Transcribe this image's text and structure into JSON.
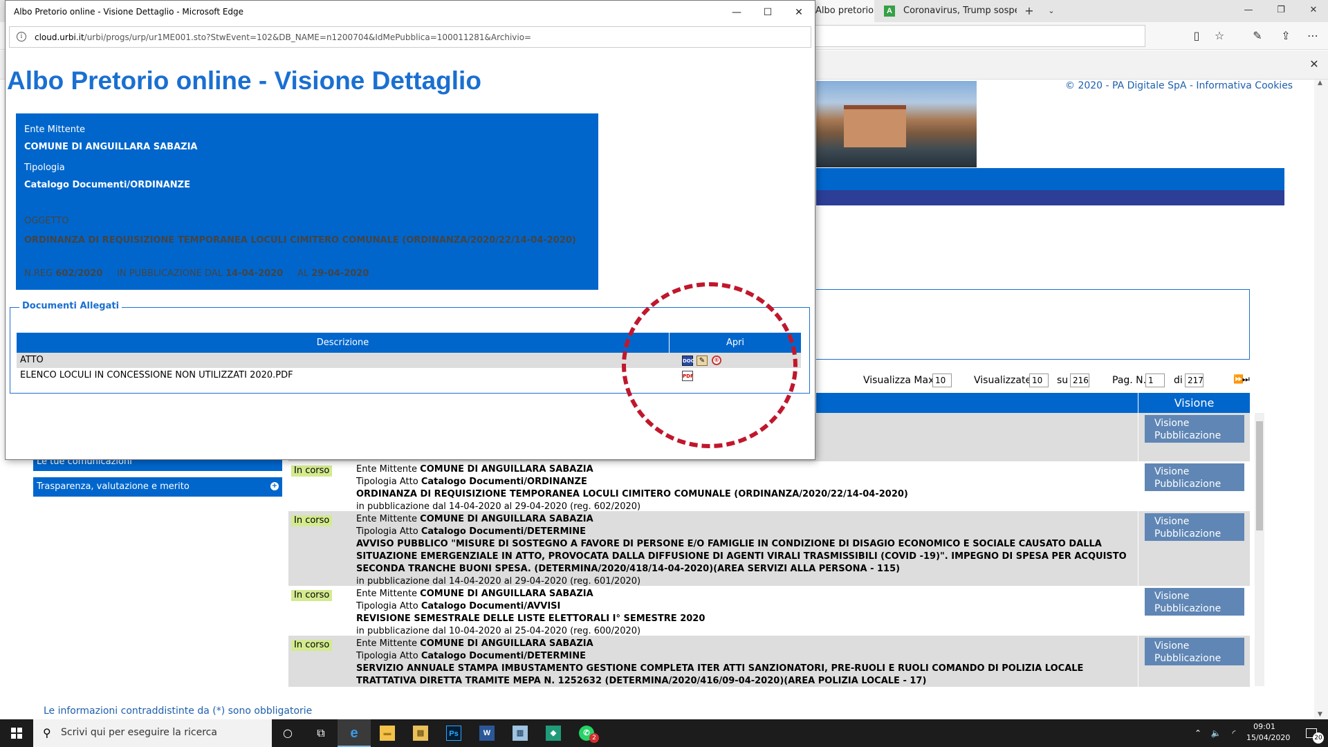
{
  "bg_browser": {
    "tabs": [
      {
        "label": "Albo pretorio o"
      },
      {
        "label": "Coronavirus, Trump sospende",
        "favicon": "A"
      }
    ],
    "window_controls": {
      "minimize": "—",
      "maximize": "❐",
      "close": "✕"
    },
    "notify_close": "✕"
  },
  "bg_page": {
    "copyright": "© 2020 - PA Digitale SpA - Informativa Cookies",
    "pager": {
      "visualizza_max_label": "Visualizza Max.",
      "visualizza_max_value": "10",
      "visualizzate_label": "Visualizzate",
      "visualizzate_value": "10",
      "su_label": "su",
      "su_value": "216",
      "pag_label": "Pag. N.",
      "pag_value": "1",
      "di_label": "di",
      "di_value": "217",
      "nav": "⏩⏭"
    },
    "list_header_visione": "Visione",
    "sidebar": [
      {
        "label": "Le tue comunicazioni"
      },
      {
        "label": "Trasparenza, valutazione e merito"
      }
    ],
    "rows": [
      {
        "status": "",
        "text": [],
        "button": "Visione Pubblicazione"
      },
      {
        "status": "In corso",
        "ente_label": "Ente Mittente ",
        "ente": "COMUNE DI ANGUILLARA SABAZIA",
        "tipologia_label": "Tipologia Atto ",
        "tipologia": "Catalogo Documenti/ORDINANZE",
        "oggetto": "ORDINANZA DI REQUISIZIONE TEMPORANEA LOCULI CIMITERO COMUNALE (ORDINANZA/2020/22/14-04-2020)",
        "pubblicazione": "in pubblicazione dal 14-04-2020 al 29-04-2020 (reg. 602/2020)",
        "button": "Visione Pubblicazione"
      },
      {
        "status": "In corso",
        "ente_label": "Ente Mittente ",
        "ente": "COMUNE DI ANGUILLARA SABAZIA",
        "tipologia_label": "Tipologia Atto ",
        "tipologia": "Catalogo Documenti/DETERMINE",
        "oggetto": "AVVISO PUBBLICO \"MISURE DI SOSTEGNO A FAVORE DI PERSONE E/O FAMIGLIE IN CONDIZIONE DI DISAGIO ECONOMICO E SOCIALE CAUSATO DALLA SITUAZIONE EMERGENZIALE IN ATTO, PROVOCATA DALLA DIFFUSIONE DI AGENTI VIRALI TRASMISSIBILI (COVID -19)\". IMPEGNO DI SPESA PER ACQUISTO SECONDA TRANCHE BUONI SPESA. (DETERMINA/2020/418/14-04-2020)(AREA SERVIZI ALLA PERSONA - 115)",
        "pubblicazione": "in pubblicazione dal 14-04-2020 al 29-04-2020 (reg. 601/2020)",
        "button": "Visione Pubblicazione"
      },
      {
        "status": "In corso",
        "ente_label": "Ente Mittente ",
        "ente": "COMUNE DI ANGUILLARA SABAZIA",
        "tipologia_label": "Tipologia Atto ",
        "tipologia": "Catalogo Documenti/AVVISI",
        "oggetto": "REVISIONE SEMESTRALE DELLE LISTE ELETTORALI I° SEMESTRE 2020",
        "pubblicazione": "in pubblicazione dal 10-04-2020 al 25-04-2020 (reg. 600/2020)",
        "button": "Visione Pubblicazione"
      },
      {
        "status": "In corso",
        "ente_label": "Ente Mittente ",
        "ente": "COMUNE DI ANGUILLARA SABAZIA",
        "tipologia_label": "Tipologia Atto ",
        "tipologia": "Catalogo Documenti/DETERMINE",
        "oggetto": "SERVIZIO ANNUALE STAMPA IMBUSTAMENTO GESTIONE COMPLETA ITER ATTI SANZIONATORI, PRE-RUOLI E RUOLI COMANDO DI POLIZIA LOCALE TRATTATIVA DIRETTA TRAMITE MEPA N. 1252632 (DETERMINA/2020/416/09-04-2020)(AREA POLIZIA LOCALE - 17)",
        "pubblicazione": "",
        "button": "Visione Pubblicazione"
      }
    ],
    "required_note": "Le informazioni contraddistinte da (*) sono obbligatorie"
  },
  "popup": {
    "window_title": "Albo Pretorio online - Visione Dettaglio - Microsoft Edge",
    "controls": {
      "minimize": "—",
      "maximize": "☐",
      "close": "✕"
    },
    "url_host": "cloud.urbi.it",
    "url_path": "/urbi/progs/urp/ur1ME001.sto?StwEvent=102&DB_NAME=n1200704&IdMePubblica=100011281&Archivio=",
    "info_icon": "i",
    "title": "Albo Pretorio online - Visione Dettaglio",
    "ente_label": "Ente Mittente",
    "ente": "COMUNE DI ANGUILLARA SABAZIA",
    "tipologia_label": "Tipologia",
    "tipologia": "Catalogo Documenti/ORDINANZE",
    "oggetto_label": "OGGETTO",
    "oggetto": "ORDINANZA DI REQUISIZIONE TEMPORANEA LOCULI CIMITERO COMUNALE (ORDINANZA/2020/22/14-04-2020)",
    "nreg_label": "N.REG",
    "nreg": "602/2020",
    "dal_label": "IN PUBBLICAZIONE DAL",
    "dal": "14-04-2020",
    "al_label": "AL",
    "al": "29-04-2020",
    "attachments": {
      "legend": "Documenti Allegati",
      "col_descrizione": "Descrizione",
      "col_apri": "Apri",
      "rows": [
        {
          "descrizione": "ATTO",
          "icons": [
            "document-icon",
            "signature-icon",
            "seal-icon"
          ]
        },
        {
          "descrizione": "ELENCO LOCULI IN CONCESSIONE NON UTILIZZATI 2020.PDF",
          "icons": [
            "pdf-icon"
          ]
        }
      ],
      "icon_glyphs": {
        "doc": "DOC",
        "sign": "✎",
        "seal": "®",
        "pdf": "PDF"
      }
    }
  },
  "taskbar": {
    "search_placeholder": "Scrivi qui per eseguire la ricerca",
    "search_icon": "⚲",
    "cortana_icon": "○",
    "taskview_icon": "⧉",
    "apps": [
      {
        "name": "edge",
        "glyph": "e"
      },
      {
        "name": "file-explorer",
        "glyph": "▬"
      },
      {
        "name": "folder",
        "glyph": "▤"
      },
      {
        "name": "photoshop",
        "glyph": "Ps"
      },
      {
        "name": "word",
        "glyph": "W"
      },
      {
        "name": "notepad",
        "glyph": "▥"
      },
      {
        "name": "app-green",
        "glyph": "◆"
      },
      {
        "name": "whatsapp",
        "glyph": "✆",
        "badge": "2"
      }
    ],
    "tray": {
      "up": "⌃",
      "volume": "🔈",
      "network": "◜",
      "pen": "✎"
    },
    "clock_time": "09:01",
    "clock_date": "15/04/2020",
    "notifications": "20"
  }
}
